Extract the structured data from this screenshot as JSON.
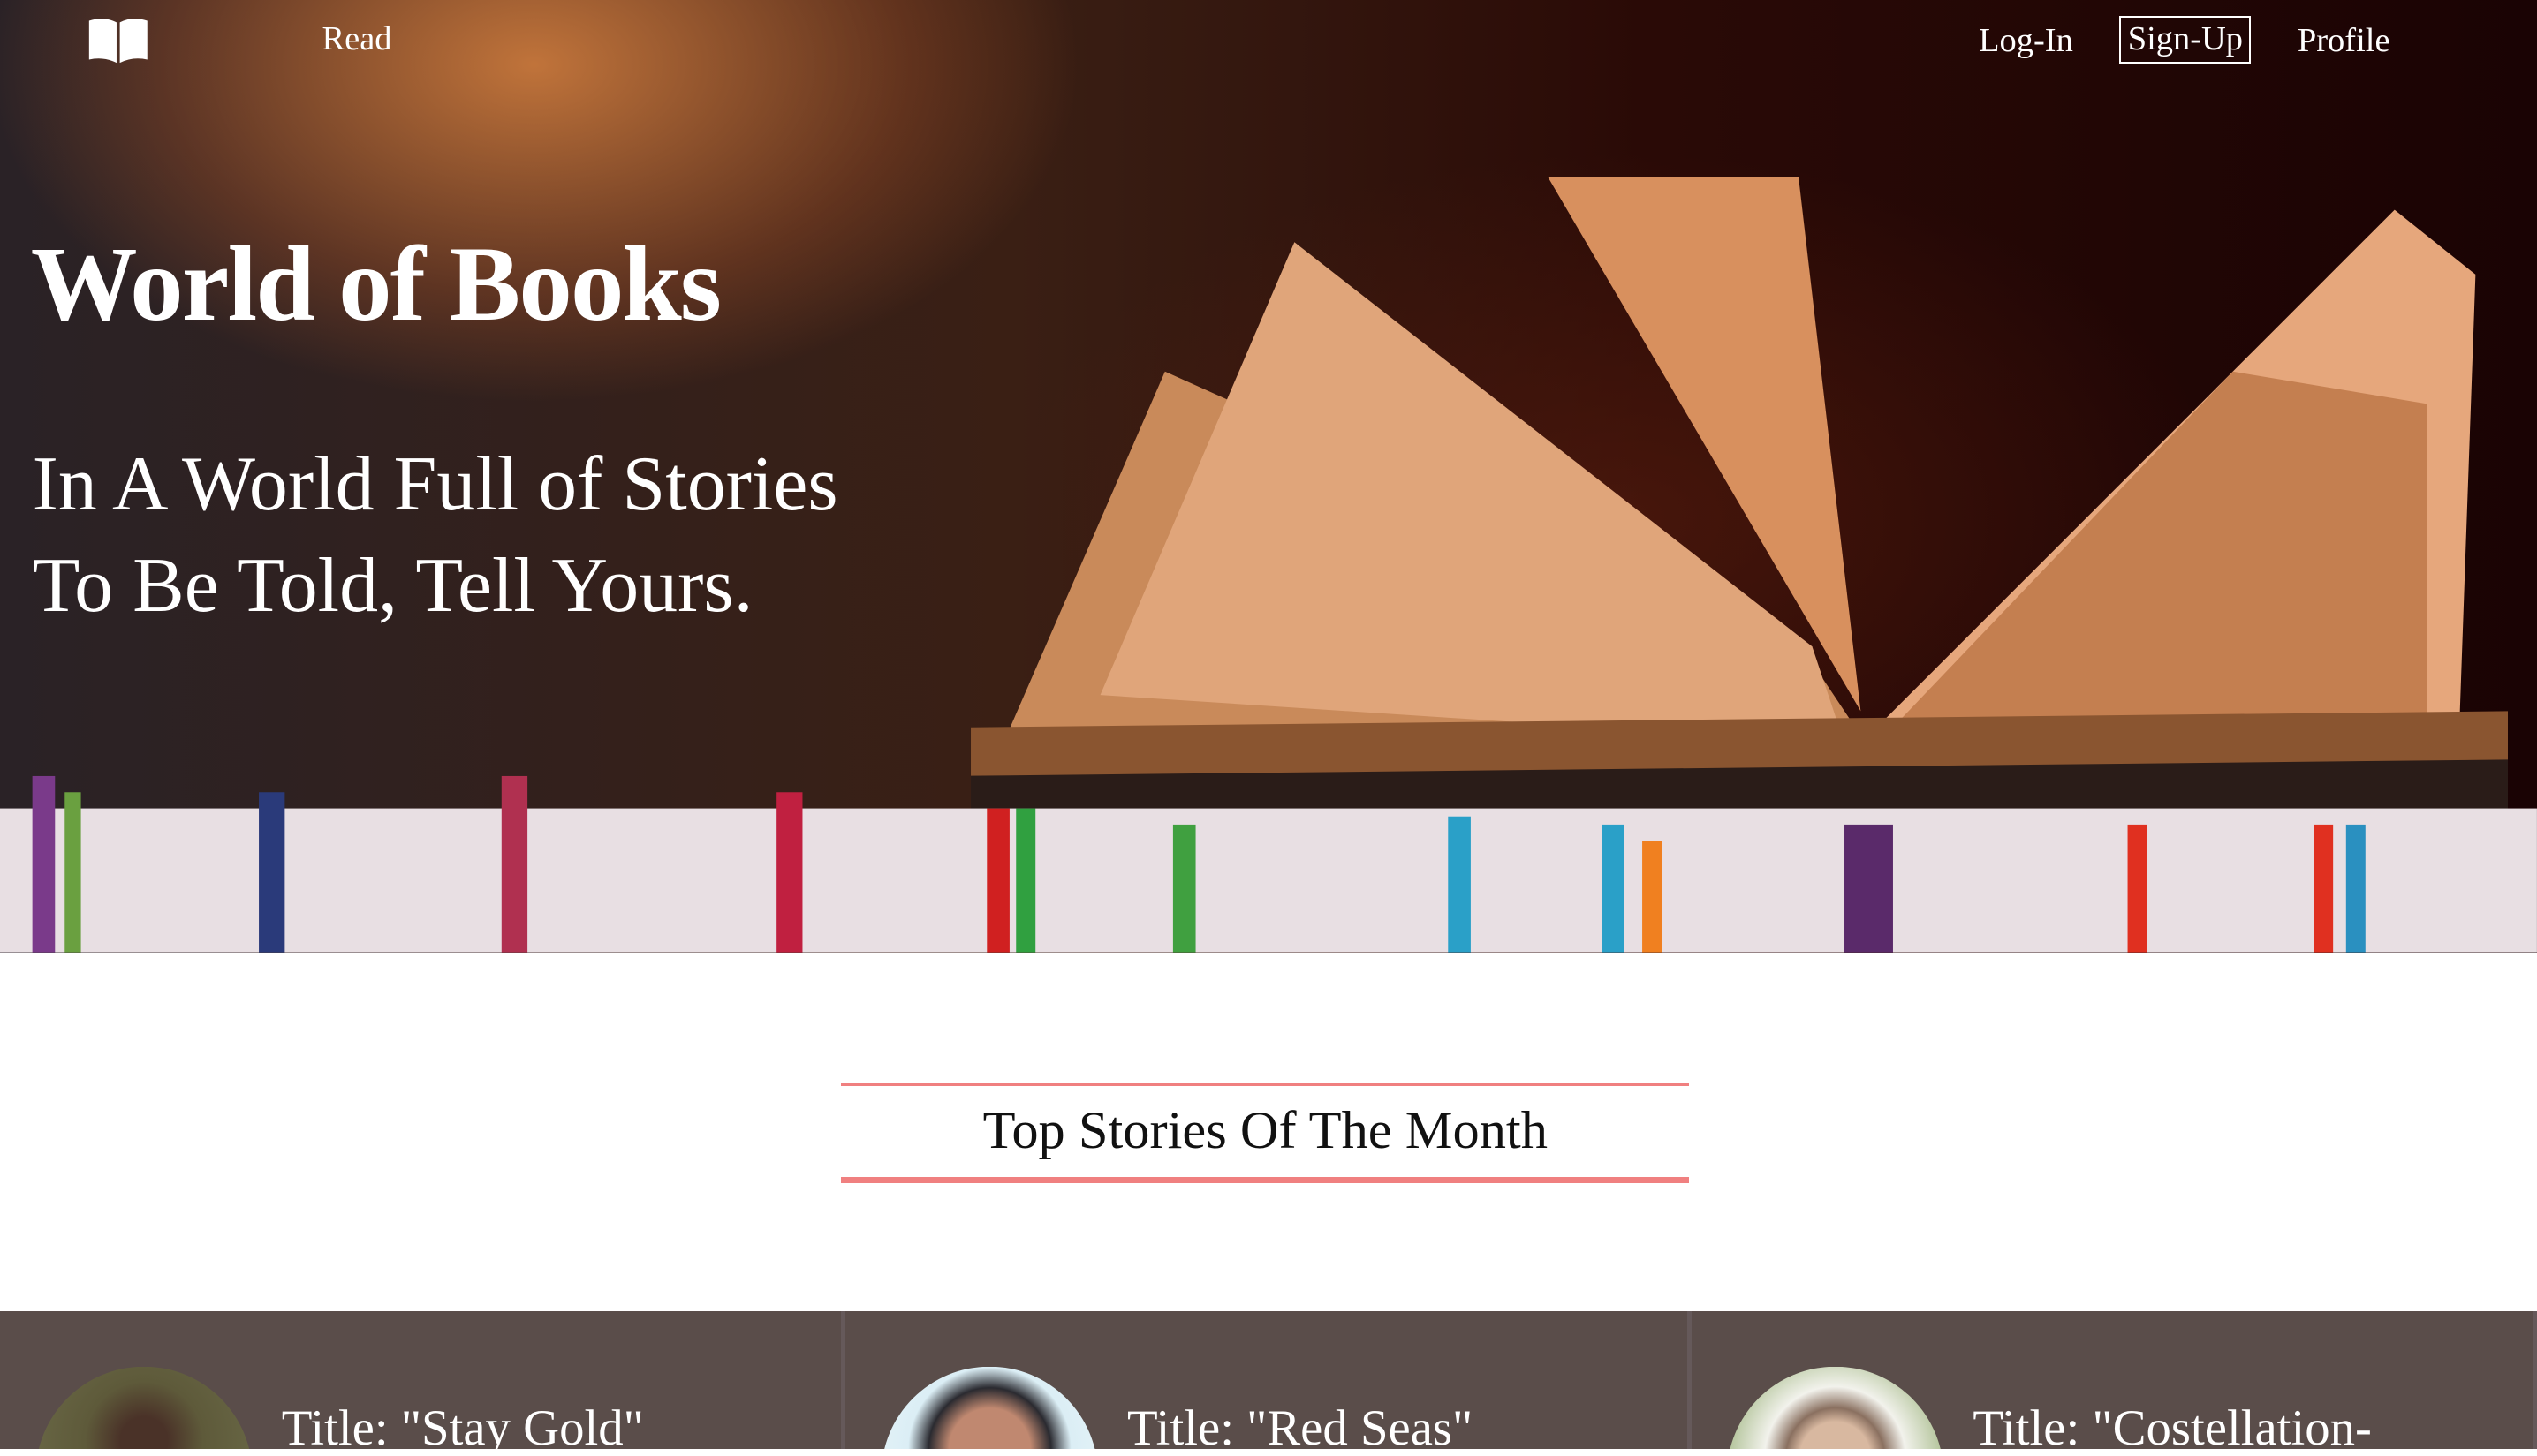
{
  "nav": {
    "logo_icon": "open-book-icon",
    "read": "Read",
    "login": "Log-In",
    "signup": "Sign-Up",
    "profile": "Profile"
  },
  "hero": {
    "title": "World of Books",
    "subtitle_line1": "In A World Full of Stories",
    "subtitle_line2": "To Be Told, Tell Yours."
  },
  "section": {
    "heading": "Top Stories Of The Month",
    "accent": "#f08080"
  },
  "cards": [
    {
      "title": "Title: \"Stay Gold\""
    },
    {
      "title": "Title: \"Red Seas\""
    },
    {
      "title": "Title: \"Costellation-"
    }
  ],
  "colors": {
    "card_bg": "#5a4d4a"
  }
}
